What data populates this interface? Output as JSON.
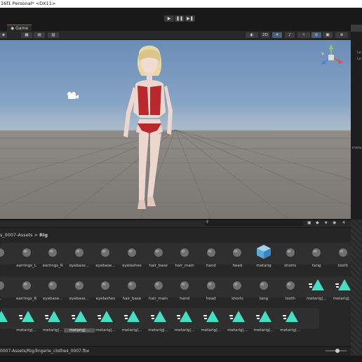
{
  "window": {
    "title": "16f1 Personal* <DX11>"
  },
  "toolbar": {
    "play_icon": "▶",
    "pause_icon": "❚❚",
    "step_icon": "▶❚"
  },
  "game_tab": {
    "label": "Game"
  },
  "scene_toolbar": {
    "mode_2d": "2D"
  },
  "right_panel": {
    "texts": [
      "Le",
      "Le",
      "meta"
    ]
  },
  "project": {
    "breadcrumb_parent": "s_0007-Assets",
    "breadcrumb_sep": ">",
    "breadcrumb_current": "Rig",
    "count_label": "4"
  },
  "asset_rows": [
    [
      "",
      "earrings_L",
      "earrings_R",
      "eyebase...",
      "eyebase...",
      "eyelashes",
      "hair_base",
      "hair_main",
      "hand",
      "head",
      "metarig",
      "shorts",
      "tang",
      "tooth"
    ],
    [
      "L",
      "earrings_R",
      "eyebase...",
      "eyebase...",
      "eyelashes",
      "hair_base",
      "hair_main",
      "hand",
      "head",
      "shorts",
      "tang",
      "tooth",
      "metarig|...",
      "metarig|..."
    ],
    [
      "",
      "metarig|...",
      "metarig|...",
      "metarig|...",
      "metarig|...",
      "metarig|...",
      "metarig|...",
      "metarig|...",
      "metarig|...",
      "metarig|...",
      "metarig|...",
      "metarig|..."
    ]
  ],
  "selected_label": "metarig|...",
  "status": {
    "path": "0007-Assets/Rig/lingerie_clothes_0007.fbx"
  },
  "colors": {
    "accent": "#44e0c6",
    "selection": "#3a79bb"
  }
}
